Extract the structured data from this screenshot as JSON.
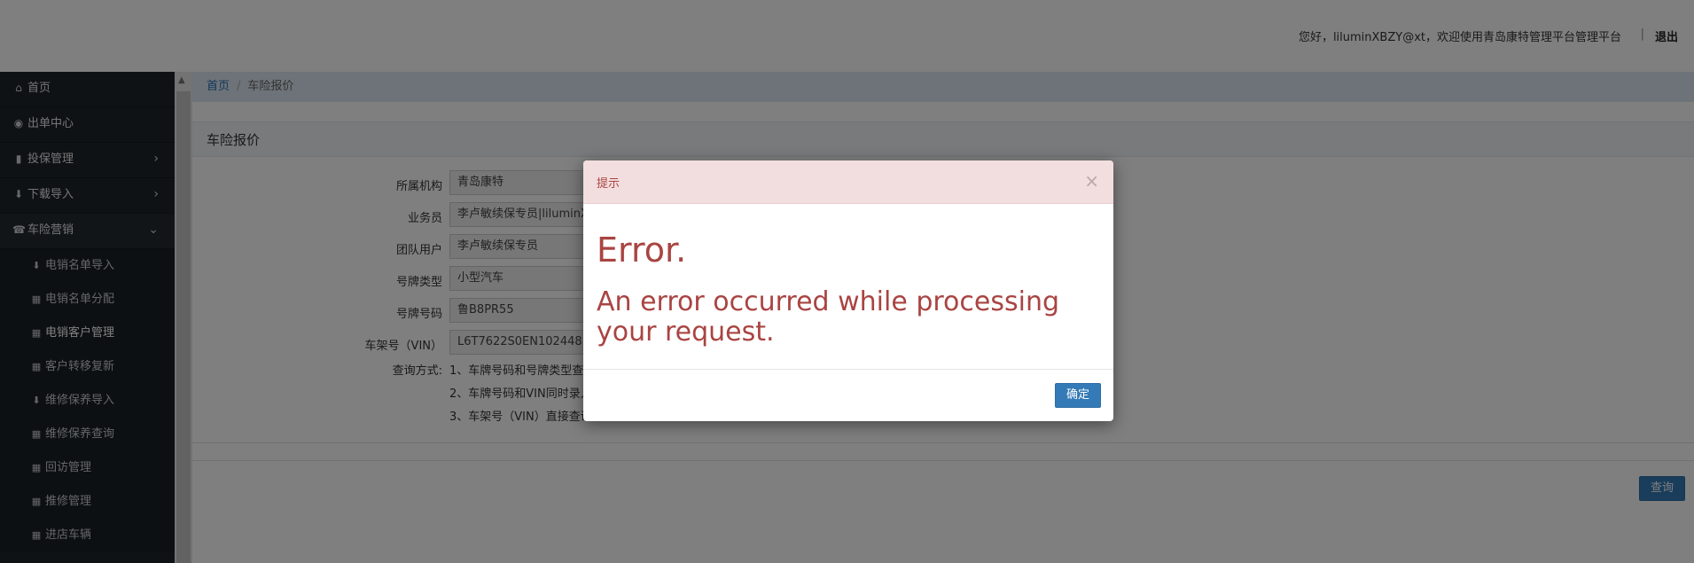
{
  "header": {
    "greeting": "您好，liluminXBZY@xt，欢迎使用青岛康特管理平台管理平台",
    "separator": "|",
    "logout": "退出"
  },
  "sidebar": {
    "items": [
      {
        "icon": "home-icon",
        "glyph": "⌂",
        "label": "首页"
      },
      {
        "icon": "globe-icon",
        "glyph": "◉",
        "label": "出单中心"
      },
      {
        "icon": "file-icon",
        "glyph": "▮",
        "label": "投保管理"
      },
      {
        "icon": "download-icon",
        "glyph": "⬇",
        "label": "下载导入"
      },
      {
        "icon": "phone-icon",
        "glyph": "☎",
        "label": "车险营销"
      }
    ],
    "sub_items": [
      {
        "icon": "import-icon",
        "glyph": "⬇",
        "label": "电销名单导入"
      },
      {
        "icon": "grid-icon",
        "glyph": "▦",
        "label": "电销名单分配"
      },
      {
        "icon": "grid-icon",
        "glyph": "▦",
        "label": "电销客户管理"
      },
      {
        "icon": "grid-icon",
        "glyph": "▦",
        "label": "客户转移复新"
      },
      {
        "icon": "import-icon",
        "glyph": "⬇",
        "label": "维修保养导入"
      },
      {
        "icon": "grid-icon",
        "glyph": "▦",
        "label": "维修保养查询"
      },
      {
        "icon": "grid-icon",
        "glyph": "▦",
        "label": "回访管理"
      },
      {
        "icon": "grid-icon",
        "glyph": "▦",
        "label": "推修管理"
      },
      {
        "icon": "grid-icon",
        "glyph": "▦",
        "label": "进店车辆"
      }
    ]
  },
  "breadcrumb": {
    "home": "首页",
    "sep": "/",
    "current": "车险报价"
  },
  "panel": {
    "title": "车险报价"
  },
  "form": {
    "org_label": "所属机构",
    "org_value": "青岛康特",
    "salesman_label": "业务员",
    "salesman_value": "李卢敏续保专员|liluminXBZY@xt",
    "team_label": "团队用户",
    "team_value": "李卢敏续保专员",
    "plate_type_label": "号牌类型",
    "plate_type_value": "小型汽车",
    "plate_no_label": "号牌号码",
    "plate_no_value": "鲁B8PR55",
    "vin_label": "车架号（VIN）",
    "vin_value": "L6T7622S0EN102448",
    "query_label": "查询方式:",
    "query_line1": "1、车牌号码和号牌类型查询",
    "query_line2": "2、车牌号码和VIN同时录入",
    "query_line3": "3、车架号（VIN）直接查询",
    "query_button": "查询"
  },
  "modal": {
    "title": "提示",
    "close": "×",
    "heading": "Error.",
    "message": "An error occurred while processing your request.",
    "ok": "确定"
  },
  "colors": {
    "primary": "#337ab7",
    "danger_text": "#a94442",
    "sidebar_bg": "#1f252b"
  }
}
